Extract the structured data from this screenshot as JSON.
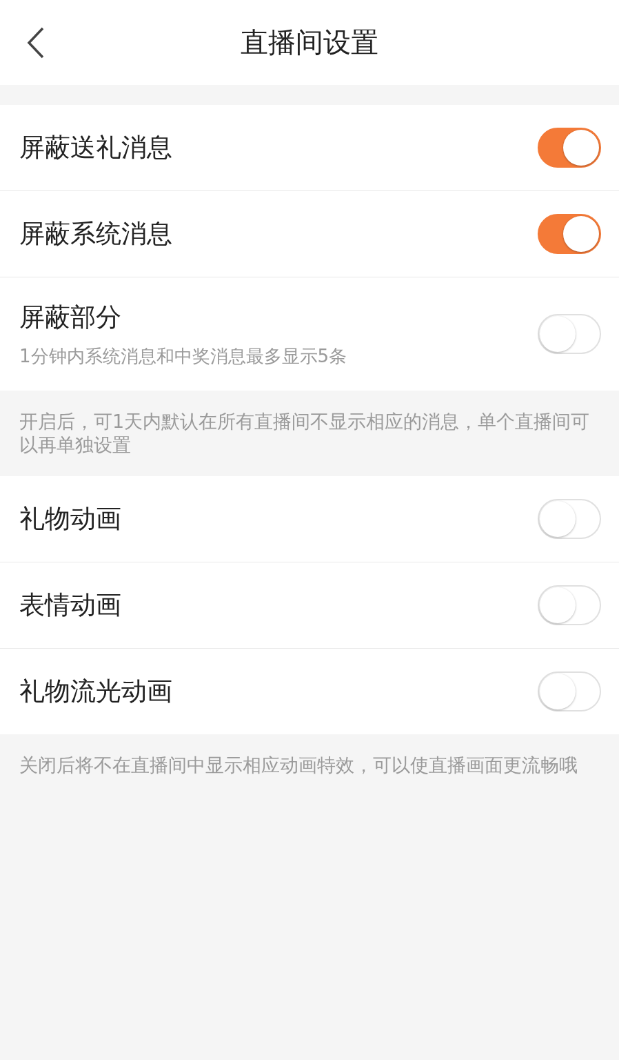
{
  "header": {
    "title": "直播间设置"
  },
  "groups": [
    {
      "items": [
        {
          "label": "屏蔽送礼消息",
          "on": true
        },
        {
          "label": "屏蔽系统消息",
          "on": true
        },
        {
          "label": "屏蔽部分",
          "subtitle": "1分钟内系统消息和中奖消息最多显示5条",
          "on": false
        }
      ],
      "note": "开启后，可1天内默认在所有直播间不显示相应的消息，单个直播间可以再单独设置"
    },
    {
      "items": [
        {
          "label": "礼物动画",
          "on": false
        },
        {
          "label": "表情动画",
          "on": false
        },
        {
          "label": "礼物流光动画",
          "on": false
        }
      ],
      "note": "关闭后将不在直播间中显示相应动画特效，可以使直播画面更流畅哦"
    }
  ]
}
